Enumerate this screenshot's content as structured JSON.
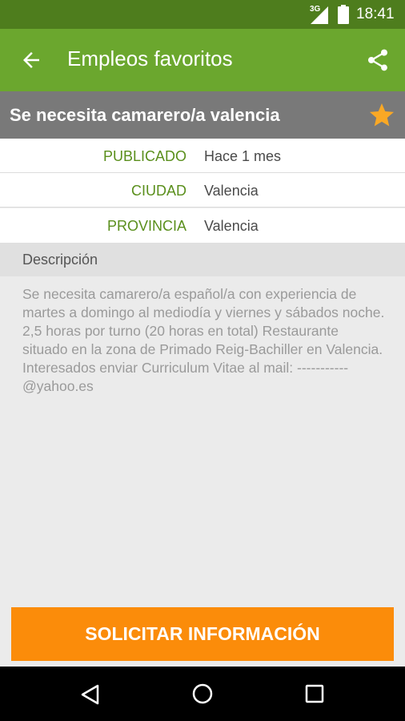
{
  "status_bar": {
    "network": "3G",
    "time": "18:41"
  },
  "app_bar": {
    "title": "Empleos favoritos",
    "back_icon": "arrow-left-icon",
    "share_icon": "share-icon"
  },
  "job": {
    "title": "Se necesita camarero/a valencia",
    "favorite": true,
    "favorite_icon": "star-icon"
  },
  "details": [
    {
      "label": "PUBLICADO",
      "value": "Hace 1 mes"
    },
    {
      "label": "CIUDAD",
      "value": "Valencia"
    },
    {
      "label": "PROVINCIA",
      "value": "Valencia"
    }
  ],
  "description": {
    "heading": "Descripción",
    "text": "Se necesita camarero/a español/a con experiencia de martes a domingo al mediodía y viernes y sábados noche. 2,5 horas por turno (20 horas en total) Restaurante situado en la zona de Primado Reig-Bachiller en Valencia. Interesados enviar Curriculum Vitae al mail: -----------@yahoo.es"
  },
  "action": {
    "apply_label": "SOLICITAR INFORMACIÓN"
  },
  "colors": {
    "status_bar": "#4e7d1d",
    "app_bar": "#6ba72e",
    "job_header": "#797979",
    "label_green": "#5a8f1c",
    "accent_orange": "#fb8c0a",
    "star": "#f9a825"
  },
  "nav": {
    "back_icon": "nav-back-icon",
    "home_icon": "nav-home-icon",
    "recents_icon": "nav-recents-icon"
  }
}
